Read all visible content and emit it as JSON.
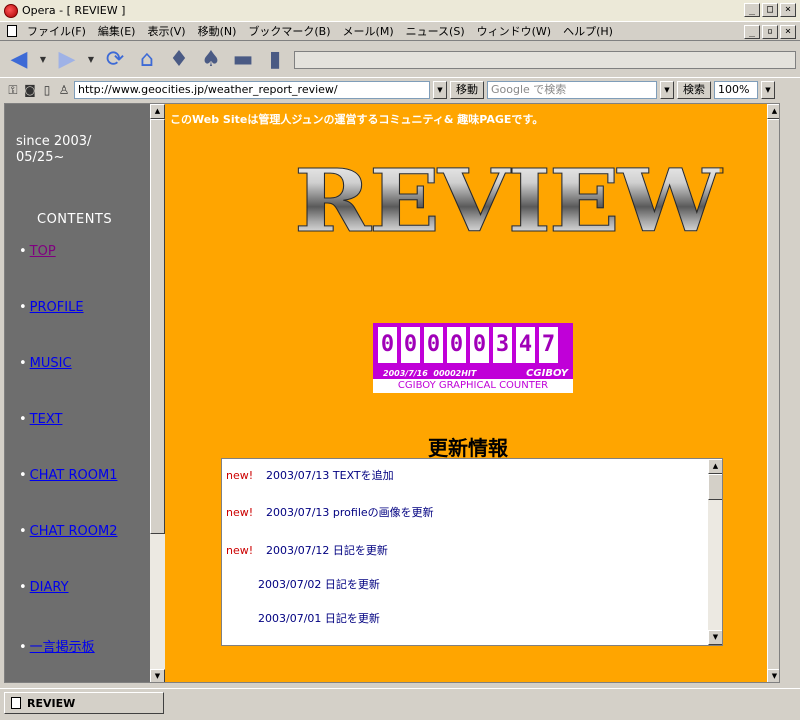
{
  "window": {
    "title": "Opera - [ REVIEW ]"
  },
  "menu": [
    "ファイル(F)",
    "編集(E)",
    "表示(V)",
    "移動(N)",
    "ブックマーク(B)",
    "メール(M)",
    "ニュース(S)",
    "ウィンドウ(W)",
    "ヘルプ(H)"
  ],
  "address": {
    "url": "http://www.geocities.jp/weather_report_review/",
    "go_label": "移動"
  },
  "search": {
    "placeholder": "Google で検索",
    "button_label": "検索"
  },
  "zoom": "100%",
  "sidebar": {
    "since_line1": "since 2003/",
    "since_line2": "05/25~",
    "contents_label": "CONTENTS",
    "items": [
      {
        "label": "TOP",
        "visited": true
      },
      {
        "label": "PROFILE",
        "visited": false
      },
      {
        "label": "MUSIC",
        "visited": false
      },
      {
        "label": "TEXT",
        "visited": false
      },
      {
        "label": "CHAT ROOM1",
        "visited": false
      },
      {
        "label": "CHAT ROOM2",
        "visited": false
      },
      {
        "label": "DIARY",
        "visited": false
      },
      {
        "label": "一言掲示板",
        "visited": false
      }
    ]
  },
  "main": {
    "intro": "このWeb Siteは管理人ジュンの運営するコミュニティ& 趣味PAGEです。",
    "logo_text": "REVIEW",
    "counter": {
      "digits": [
        "0",
        "0",
        "0",
        "0",
        "0",
        "3",
        "4",
        "7"
      ],
      "date": "2003/7/16",
      "hits": "00002HIT",
      "brand": "CGIBOY",
      "caption": "CGIBOY GRAPHICAL COUNTER"
    },
    "update_title": "更新情報",
    "news": [
      {
        "badge": "new!",
        "text": "2003/07/13 TEXTを追加"
      },
      {
        "badge": "new!",
        "text": "2003/07/13 profileの画像を更新"
      },
      {
        "badge": "new!",
        "text": "2003/07/12 日記を更新"
      },
      {
        "badge": "",
        "text": "2003/07/02 日記を更新"
      },
      {
        "badge": "",
        "text": "2003/07/01 日記を更新"
      }
    ]
  },
  "status": {
    "tab_label": "REVIEW"
  },
  "colors": {
    "page_bg": "#ffa500",
    "sidebar_bg": "#6e6e6e",
    "counter_bg": "#c000d8",
    "link": "#0000ee",
    "visited": "#800080",
    "new_badge": "#cc0000"
  }
}
